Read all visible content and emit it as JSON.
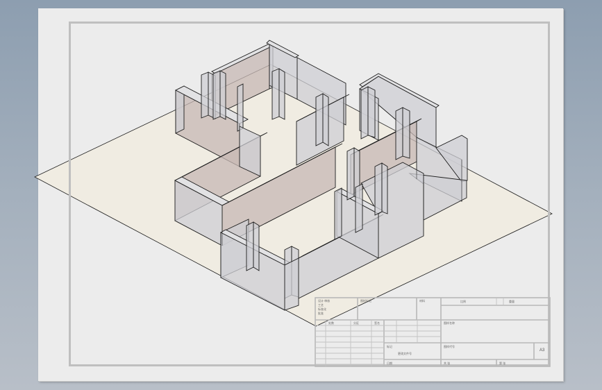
{
  "sheet": {
    "paper_color": "#ececec",
    "floor_color": "#f0ece2",
    "wall_fill_light": "#cfcfd4",
    "wall_fill_warm": "#c7b8b4",
    "edge_color": "#1c1c1c",
    "frame_color": "#bfbfbf"
  },
  "title_block": {
    "designer_label": "设计 审核",
    "process_label": "工艺",
    "standard_label": "标准化",
    "approval_label": "批准",
    "company_label": "图样标记",
    "material_label": "材料",
    "scale_label": "比例",
    "weight_label": "重量",
    "sheet_label": "共 张",
    "sheet_no_label": "第 张",
    "drawing_name_label": "图样名称",
    "drawing_no_label": "图样代号",
    "paper_size": "A3",
    "revision_labels": [
      "标记",
      "处数",
      "分区",
      "更改文件号",
      "签名",
      "日期"
    ]
  }
}
